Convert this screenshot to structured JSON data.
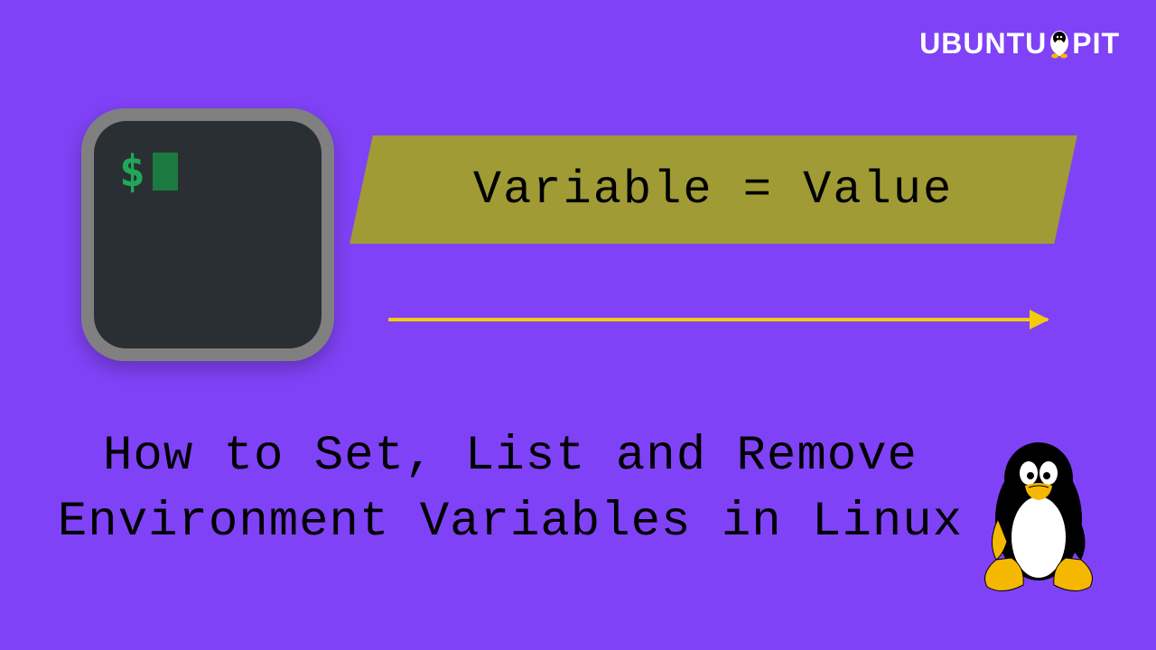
{
  "logo": {
    "part1": "UBUNTU",
    "part2": "PIT"
  },
  "terminal": {
    "prompt": "$"
  },
  "banner": {
    "text": "Variable = Value"
  },
  "title": {
    "line1": "How to Set, List and Remove",
    "line2": "Environment Variables in Linux"
  }
}
